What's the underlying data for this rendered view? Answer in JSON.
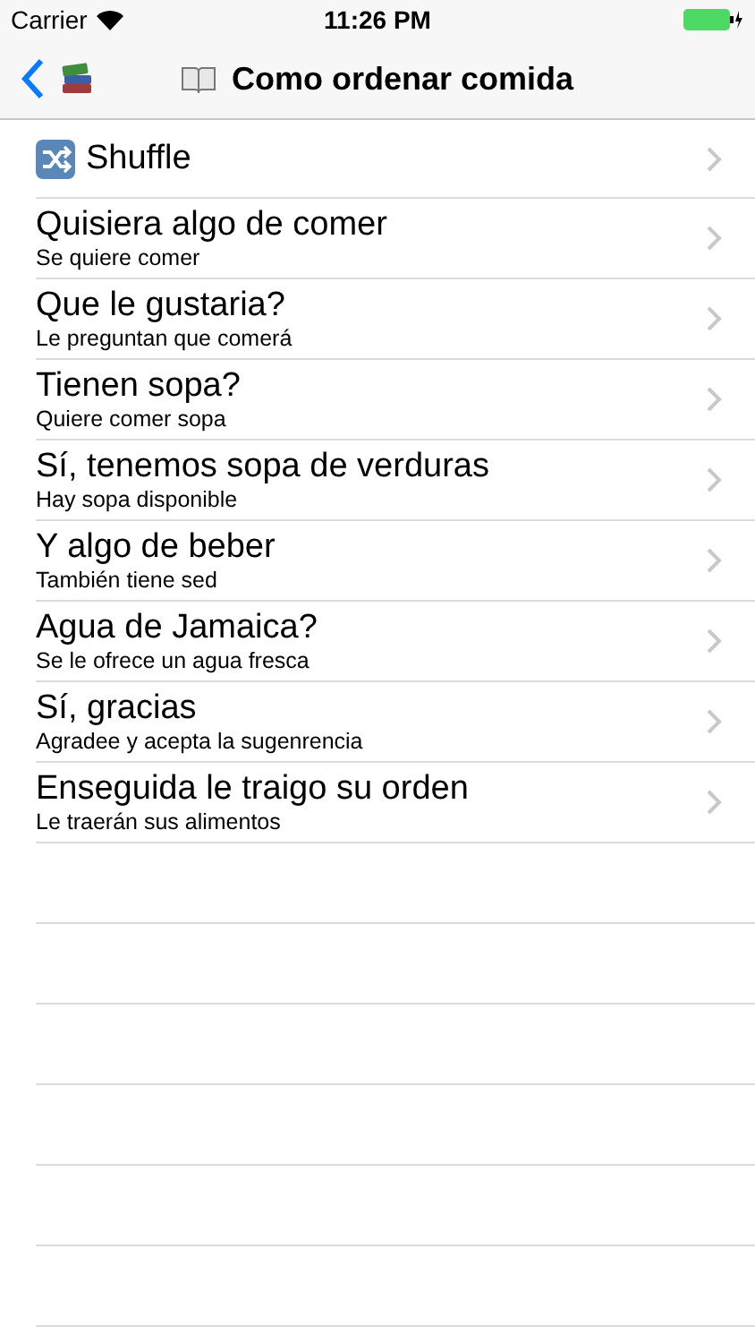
{
  "status_bar": {
    "carrier": "Carrier",
    "time": "11:26 PM"
  },
  "nav": {
    "title": "Como ordenar comida"
  },
  "shuffle": {
    "label": "Shuffle"
  },
  "phrases": [
    {
      "title": "Quisiera algo de comer",
      "subtitle": "Se quiere comer"
    },
    {
      "title": "Que le gustaria?",
      "subtitle": "Le preguntan que comerá"
    },
    {
      "title": "Tienen sopa?",
      "subtitle": "Quiere comer sopa"
    },
    {
      "title": "Sí, tenemos sopa de verduras",
      "subtitle": "Hay sopa disponible"
    },
    {
      "title": "Y algo de beber",
      "subtitle": "También tiene sed"
    },
    {
      "title": "Agua de Jamaica?",
      "subtitle": "Se le ofrece un agua fresca"
    },
    {
      "title": "Sí, gracias",
      "subtitle": "Agradee y acepta la sugenrencia"
    },
    {
      "title": "Enseguida le traigo su orden",
      "subtitle": "Le traerán sus alimentos"
    }
  ]
}
